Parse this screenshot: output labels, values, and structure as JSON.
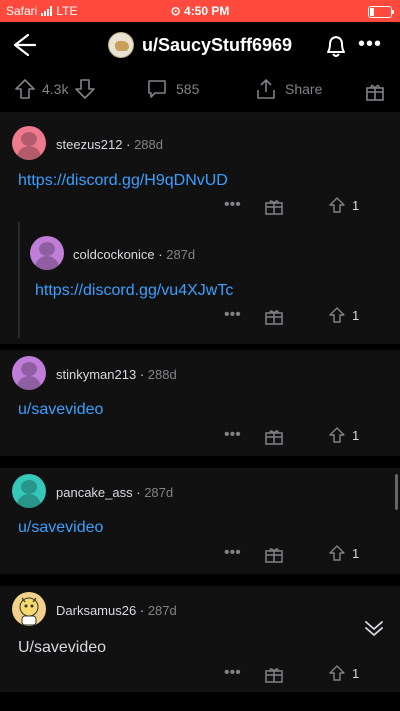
{
  "status": {
    "carrier": "Safari",
    "network": "LTE",
    "time": "4:50 PM",
    "alarm_icon": "alarm-icon",
    "battery_icon": "battery-icon"
  },
  "header": {
    "subreddit": "u/SaucyStuff6969"
  },
  "post_actions": {
    "votes": "4.3k",
    "comments": "585",
    "share": "Share"
  },
  "comments": [
    {
      "user": "steezus212",
      "age": "288d",
      "text": "https://discord.gg/H9qDNvUD",
      "score": "1",
      "avatar_color": "#ef7a8f",
      "is_link": true
    },
    {
      "user": "coldcockonice",
      "age": "287d",
      "text": "https://discord.gg/vu4XJwTc",
      "score": "1",
      "avatar_color": "#c07ed8",
      "is_link": true
    },
    {
      "user": "stinkyman213",
      "age": "288d",
      "text": "u/savevideo",
      "score": "1",
      "avatar_color": "#c07ed8",
      "is_link": true
    },
    {
      "user": "pancake_ass",
      "age": "287d",
      "text": "u/savevideo",
      "score": "1",
      "avatar_color": "#35c7b9",
      "is_link": true
    },
    {
      "user": "Darksamus26",
      "age": "287d",
      "text": "U/savevideo",
      "score": "1",
      "avatar_color": "#f2d28a",
      "is_link": false
    }
  ]
}
